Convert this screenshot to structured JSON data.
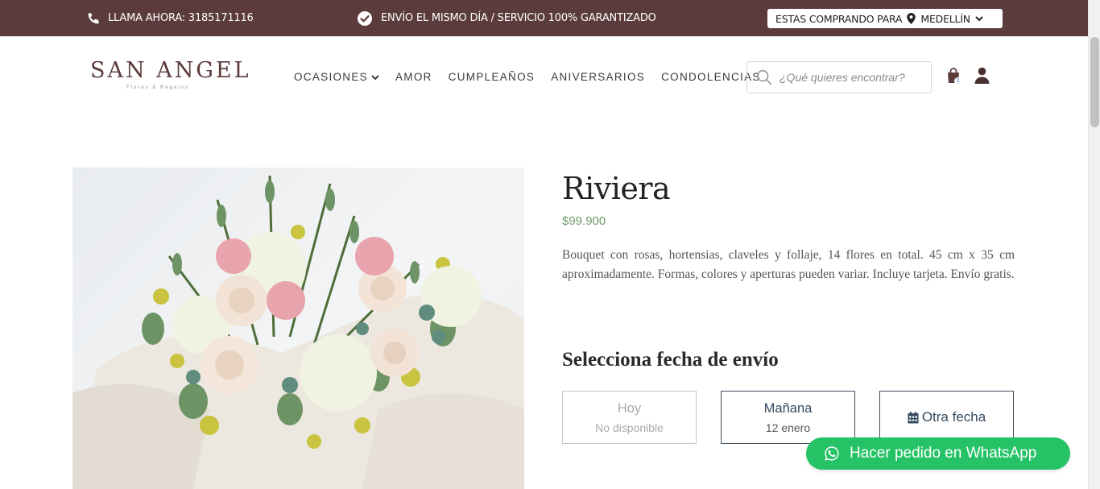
{
  "topbar": {
    "call_label": "LLAMA AHORA: 3185171116",
    "shipping_label": "ENVÍO EL MISMO DÍA / SERVICIO 100% GARANTIZADO",
    "location_prefix": "ESTAS COMPRANDO PARA",
    "location_city": "MEDELLÍN",
    "bg_color": "#5b3b3b"
  },
  "header": {
    "logo_text": "SAN ANGEL",
    "logo_subtitle": "Flores & Regalos",
    "nav": [
      {
        "label": "OCASIONES",
        "has_dropdown": true
      },
      {
        "label": "AMOR"
      },
      {
        "label": "CUMPLEAÑOS"
      },
      {
        "label": "ANIVERSARIOS"
      },
      {
        "label": "CONDOLENCIAS"
      }
    ],
    "search_placeholder": "¿Qué quieres encontrar?",
    "cart_count": "0",
    "icons": [
      "search-icon",
      "cart-icon",
      "user-icon"
    ]
  },
  "product": {
    "title": "Riviera",
    "price": "$99.900",
    "description": "Bouquet con rosas, hortensias, claveles y follaje, 14 flores en total. 45  cm x 35 cm aproximadamente. Formas, colores y aperturas pueden variar. Incluye tarjeta. Envío gratis.",
    "price_color": "#6d9e6d"
  },
  "delivery": {
    "heading": "Selecciona fecha de envío",
    "options": [
      {
        "label": "Hoy",
        "sub": "No disponible",
        "available": false
      },
      {
        "label": "Mañana",
        "sub": "12 enero",
        "available": true
      },
      {
        "label": "Otra fecha",
        "icon": "calendar-icon",
        "available": true
      }
    ]
  },
  "whatsapp": {
    "label": "Hacer pedido en WhatsApp",
    "color": "#25c366"
  }
}
